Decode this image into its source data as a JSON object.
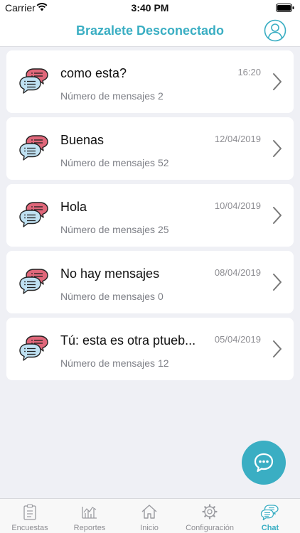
{
  "status_bar": {
    "carrier": "Carrier",
    "time": "3:40 PM"
  },
  "nav": {
    "title": "Brazalete Desconectado"
  },
  "chats": [
    {
      "title": "como esta?",
      "date": "16:20",
      "count": "Número de mensajes 2"
    },
    {
      "title": "Buenas",
      "date": "12/04/2019",
      "count": "Número de mensajes 52"
    },
    {
      "title": "Hola",
      "date": "10/04/2019",
      "count": "Número de mensajes 25"
    },
    {
      "title": "No hay mensajes",
      "date": "08/04/2019",
      "count": "Número de mensajes 0"
    },
    {
      "title": "Tú: esta es otra ptueb...",
      "date": "05/04/2019",
      "count": "Número de mensajes 12"
    }
  ],
  "tabs": [
    {
      "label": "Encuestas",
      "icon": "clipboard-icon"
    },
    {
      "label": "Reportes",
      "icon": "chart-icon"
    },
    {
      "label": "Inicio",
      "icon": "home-icon"
    },
    {
      "label": "Configuración",
      "icon": "gear-icon"
    },
    {
      "label": "Chat",
      "icon": "chat-icon",
      "active": true
    }
  ],
  "colors": {
    "accent": "#3aaec3",
    "bubble_red": "#e0677a",
    "bubble_blue": "#bfe1f2",
    "background": "#eff0f5"
  }
}
